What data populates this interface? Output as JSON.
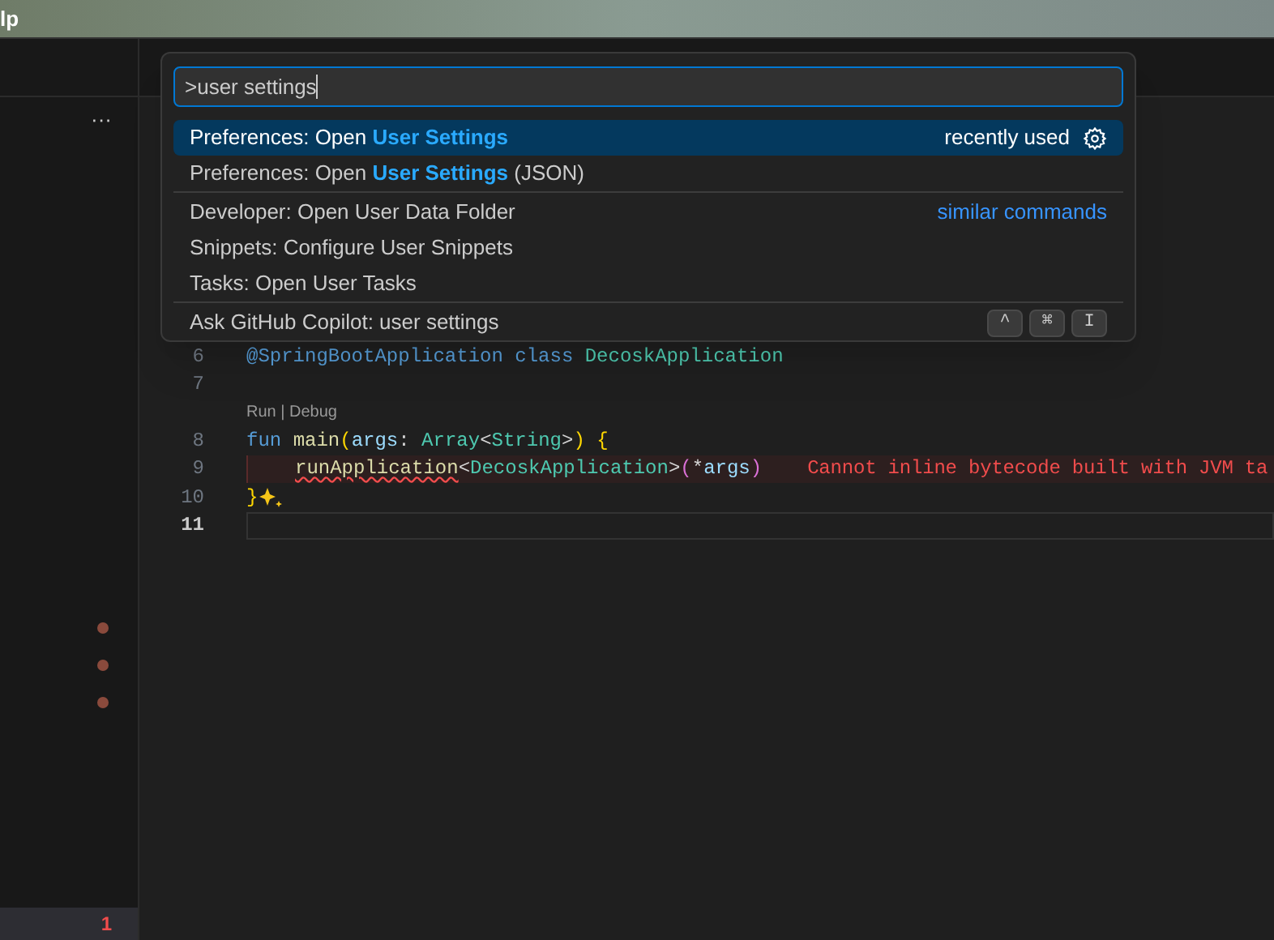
{
  "menu_bar": {
    "title": "lp"
  },
  "sidebar": {
    "more": "···",
    "badge": "1"
  },
  "command_palette": {
    "query": ">user settings",
    "groups": [
      {
        "items": [
          {
            "parts": [
              {
                "text": "Preferences: Open ",
                "highlight": false
              },
              {
                "text": "User Settings",
                "highlight": true
              }
            ],
            "selected": true,
            "kind": "recent",
            "detail": "recently used"
          },
          {
            "parts": [
              {
                "text": "Preferences: Open ",
                "highlight": false
              },
              {
                "text": "User Settings",
                "highlight": true
              },
              {
                "text": " (JSON)",
                "highlight": false
              }
            ],
            "selected": false,
            "kind": "plain"
          }
        ]
      },
      {
        "items": [
          {
            "parts": [
              {
                "text": "Developer: Open User Data Folder",
                "highlight": false
              }
            ],
            "selected": false,
            "kind": "similar",
            "detail": "similar commands"
          },
          {
            "parts": [
              {
                "text": "Snippets: Configure User Snippets",
                "highlight": false
              }
            ],
            "selected": false,
            "kind": "plain"
          },
          {
            "parts": [
              {
                "text": "Tasks: Open User Tasks",
                "highlight": false
              }
            ],
            "selected": false,
            "kind": "plain"
          }
        ]
      },
      {
        "items": [
          {
            "parts": [
              {
                "text": "Ask GitHub Copilot: user settings",
                "highlight": false
              }
            ],
            "selected": false,
            "kind": "keys",
            "keys": [
              "^",
              "⌘",
              "I"
            ]
          }
        ]
      }
    ]
  },
  "editor": {
    "lines": [
      {
        "number": "6",
        "current": false,
        "error": false,
        "tokens": [
          {
            "text": "@SpringBootApplication ",
            "kind": "annotation"
          },
          {
            "text": "class ",
            "kind": "keyword"
          },
          {
            "text": "DecoskApplication",
            "kind": "type"
          }
        ]
      },
      {
        "number": "7",
        "current": false,
        "error": false
      },
      {
        "kind": "codelens",
        "text": "Run | Debug"
      },
      {
        "number": "8",
        "current": false,
        "error": false,
        "tokens": [
          {
            "text": "fun ",
            "kind": "keyword"
          },
          {
            "text": "main",
            "kind": "function"
          },
          {
            "text": "(",
            "kind": "bracket"
          },
          {
            "text": "args",
            "kind": "param"
          },
          {
            "text": ": ",
            "kind": "plain"
          },
          {
            "text": "Array",
            "kind": "type"
          },
          {
            "text": "<",
            "kind": "plain"
          },
          {
            "text": "String",
            "kind": "type"
          },
          {
            "text": ">",
            "kind": "plain"
          },
          {
            "text": ") ",
            "kind": "bracket"
          },
          {
            "text": "{",
            "kind": "bracket"
          }
        ],
        "children": [
          {
            "number": "9",
            "current": false,
            "error": true,
            "message": "Cannot inline bytecode built with JVM ta",
            "tokens": [
              {
                "text": "runApplication",
                "kind": "squiggle"
              },
              {
                "text": "<",
                "kind": "plain"
              },
              {
                "text": "DecoskApplication",
                "kind": "type"
              },
              {
                "text": ">",
                "kind": "plain"
              },
              {
                "text": "(",
                "kind": "bracket2"
              },
              {
                "text": "*",
                "kind": "plain"
              },
              {
                "text": "args",
                "kind": "param"
              },
              {
                "text": ")",
                "kind": "bracket2"
              }
            ]
          }
        ]
      },
      {
        "number": "10",
        "current": false,
        "error": false,
        "sparkle": true,
        "tokens": [
          {
            "text": "}",
            "kind": "bracket"
          }
        ]
      },
      {
        "number": "11",
        "current": true,
        "error": false
      }
    ]
  }
}
